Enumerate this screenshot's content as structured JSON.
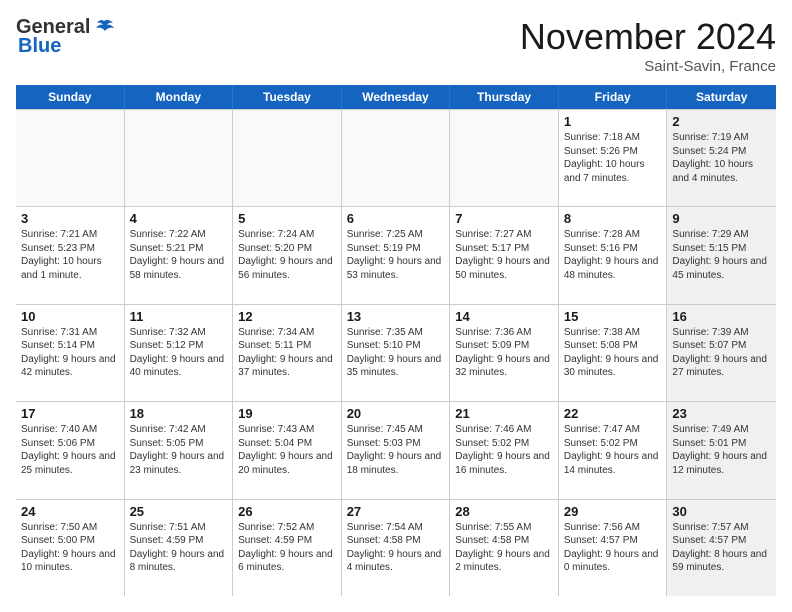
{
  "header": {
    "logo_general": "General",
    "logo_blue": "Blue",
    "month_title": "November 2024",
    "location": "Saint-Savin, France"
  },
  "days_of_week": [
    "Sunday",
    "Monday",
    "Tuesday",
    "Wednesday",
    "Thursday",
    "Friday",
    "Saturday"
  ],
  "rows": [
    {
      "cells": [
        {
          "day": "",
          "text": "",
          "empty": true
        },
        {
          "day": "",
          "text": "",
          "empty": true
        },
        {
          "day": "",
          "text": "",
          "empty": true
        },
        {
          "day": "",
          "text": "",
          "empty": true
        },
        {
          "day": "",
          "text": "",
          "empty": true
        },
        {
          "day": "1",
          "text": "Sunrise: 7:18 AM\nSunset: 5:26 PM\nDaylight: 10 hours and 7 minutes.",
          "empty": false
        },
        {
          "day": "2",
          "text": "Sunrise: 7:19 AM\nSunset: 5:24 PM\nDaylight: 10 hours and 4 minutes.",
          "empty": false,
          "shaded": true
        }
      ]
    },
    {
      "cells": [
        {
          "day": "3",
          "text": "Sunrise: 7:21 AM\nSunset: 5:23 PM\nDaylight: 10 hours and 1 minute.",
          "empty": false
        },
        {
          "day": "4",
          "text": "Sunrise: 7:22 AM\nSunset: 5:21 PM\nDaylight: 9 hours and 58 minutes.",
          "empty": false
        },
        {
          "day": "5",
          "text": "Sunrise: 7:24 AM\nSunset: 5:20 PM\nDaylight: 9 hours and 56 minutes.",
          "empty": false
        },
        {
          "day": "6",
          "text": "Sunrise: 7:25 AM\nSunset: 5:19 PM\nDaylight: 9 hours and 53 minutes.",
          "empty": false
        },
        {
          "day": "7",
          "text": "Sunrise: 7:27 AM\nSunset: 5:17 PM\nDaylight: 9 hours and 50 minutes.",
          "empty": false
        },
        {
          "day": "8",
          "text": "Sunrise: 7:28 AM\nSunset: 5:16 PM\nDaylight: 9 hours and 48 minutes.",
          "empty": false
        },
        {
          "day": "9",
          "text": "Sunrise: 7:29 AM\nSunset: 5:15 PM\nDaylight: 9 hours and 45 minutes.",
          "empty": false,
          "shaded": true
        }
      ]
    },
    {
      "cells": [
        {
          "day": "10",
          "text": "Sunrise: 7:31 AM\nSunset: 5:14 PM\nDaylight: 9 hours and 42 minutes.",
          "empty": false
        },
        {
          "day": "11",
          "text": "Sunrise: 7:32 AM\nSunset: 5:12 PM\nDaylight: 9 hours and 40 minutes.",
          "empty": false
        },
        {
          "day": "12",
          "text": "Sunrise: 7:34 AM\nSunset: 5:11 PM\nDaylight: 9 hours and 37 minutes.",
          "empty": false
        },
        {
          "day": "13",
          "text": "Sunrise: 7:35 AM\nSunset: 5:10 PM\nDaylight: 9 hours and 35 minutes.",
          "empty": false
        },
        {
          "day": "14",
          "text": "Sunrise: 7:36 AM\nSunset: 5:09 PM\nDaylight: 9 hours and 32 minutes.",
          "empty": false
        },
        {
          "day": "15",
          "text": "Sunrise: 7:38 AM\nSunset: 5:08 PM\nDaylight: 9 hours and 30 minutes.",
          "empty": false
        },
        {
          "day": "16",
          "text": "Sunrise: 7:39 AM\nSunset: 5:07 PM\nDaylight: 9 hours and 27 minutes.",
          "empty": false,
          "shaded": true
        }
      ]
    },
    {
      "cells": [
        {
          "day": "17",
          "text": "Sunrise: 7:40 AM\nSunset: 5:06 PM\nDaylight: 9 hours and 25 minutes.",
          "empty": false
        },
        {
          "day": "18",
          "text": "Sunrise: 7:42 AM\nSunset: 5:05 PM\nDaylight: 9 hours and 23 minutes.",
          "empty": false
        },
        {
          "day": "19",
          "text": "Sunrise: 7:43 AM\nSunset: 5:04 PM\nDaylight: 9 hours and 20 minutes.",
          "empty": false
        },
        {
          "day": "20",
          "text": "Sunrise: 7:45 AM\nSunset: 5:03 PM\nDaylight: 9 hours and 18 minutes.",
          "empty": false
        },
        {
          "day": "21",
          "text": "Sunrise: 7:46 AM\nSunset: 5:02 PM\nDaylight: 9 hours and 16 minutes.",
          "empty": false
        },
        {
          "day": "22",
          "text": "Sunrise: 7:47 AM\nSunset: 5:02 PM\nDaylight: 9 hours and 14 minutes.",
          "empty": false
        },
        {
          "day": "23",
          "text": "Sunrise: 7:49 AM\nSunset: 5:01 PM\nDaylight: 9 hours and 12 minutes.",
          "empty": false,
          "shaded": true
        }
      ]
    },
    {
      "cells": [
        {
          "day": "24",
          "text": "Sunrise: 7:50 AM\nSunset: 5:00 PM\nDaylight: 9 hours and 10 minutes.",
          "empty": false
        },
        {
          "day": "25",
          "text": "Sunrise: 7:51 AM\nSunset: 4:59 PM\nDaylight: 9 hours and 8 minutes.",
          "empty": false
        },
        {
          "day": "26",
          "text": "Sunrise: 7:52 AM\nSunset: 4:59 PM\nDaylight: 9 hours and 6 minutes.",
          "empty": false
        },
        {
          "day": "27",
          "text": "Sunrise: 7:54 AM\nSunset: 4:58 PM\nDaylight: 9 hours and 4 minutes.",
          "empty": false
        },
        {
          "day": "28",
          "text": "Sunrise: 7:55 AM\nSunset: 4:58 PM\nDaylight: 9 hours and 2 minutes.",
          "empty": false
        },
        {
          "day": "29",
          "text": "Sunrise: 7:56 AM\nSunset: 4:57 PM\nDaylight: 9 hours and 0 minutes.",
          "empty": false
        },
        {
          "day": "30",
          "text": "Sunrise: 7:57 AM\nSunset: 4:57 PM\nDaylight: 8 hours and 59 minutes.",
          "empty": false,
          "shaded": true
        }
      ]
    }
  ]
}
